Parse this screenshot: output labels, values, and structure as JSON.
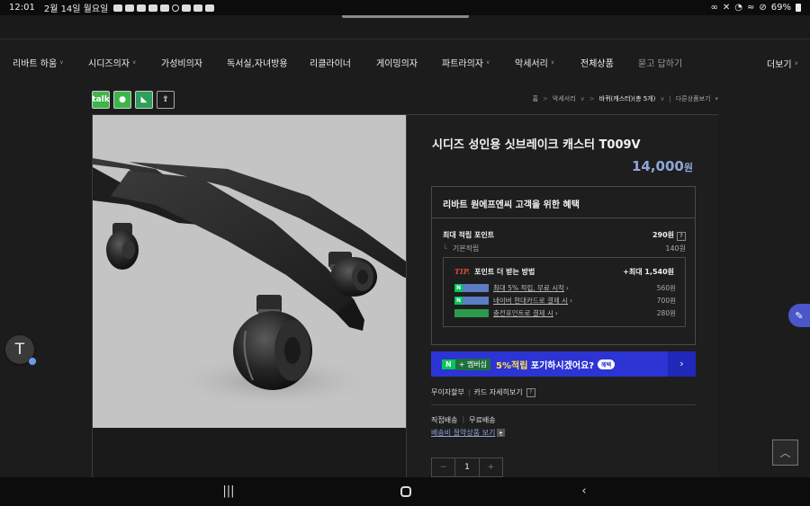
{
  "status_bar": {
    "time": "12:01",
    "date": "2월 14일 월요일",
    "battery": "69%"
  },
  "nav": {
    "items": [
      {
        "label": "리바트 하움",
        "has_dropdown": true
      },
      {
        "label": "시디즈의자",
        "has_dropdown": true
      },
      {
        "label": "가성비의자",
        "has_dropdown": false
      },
      {
        "label": "독서실,자녀방용",
        "has_dropdown": false
      },
      {
        "label": "리클라이너",
        "has_dropdown": false
      },
      {
        "label": "게이밍의자",
        "has_dropdown": false
      },
      {
        "label": "파트라의자",
        "has_dropdown": true
      },
      {
        "label": "악세서리",
        "has_dropdown": true
      },
      {
        "label": "전체상품",
        "has_dropdown": false
      },
      {
        "label": "묻고 답하기",
        "has_dropdown": false
      }
    ],
    "more": "더보기"
  },
  "breadcrumb": {
    "home": "홈",
    "category": "악세서리",
    "current": "바퀴(캐스터)(총 5개)",
    "other": "다른상품보기"
  },
  "share_icons": [
    "talk",
    "story",
    "band",
    "share"
  ],
  "product": {
    "title": "시디즈 성인용 싯브레이크 캐스터 T009V",
    "price": "14,000",
    "currency": "원"
  },
  "benefit": {
    "header": "리바트 원에프엔씨 고객을 위한 혜택",
    "max_points_label": "최대 적립 포인트",
    "max_points_value": "290원",
    "help": "?",
    "basic_label": "기본적립",
    "basic_value": "140원",
    "tip": {
      "tag": "TIP.",
      "title": "포인트 더 받는 방법",
      "max": "+최대 1,540원",
      "rows": [
        {
          "text": "최대 5% 적립, 무료 시작",
          "amount": "560원",
          "badge": "N"
        },
        {
          "text": "네이버 현대카드로 결제 시",
          "amount": "700원",
          "badge": "N"
        },
        {
          "text": "충전포인트로 결제 시",
          "amount": "280원",
          "badge": ""
        }
      ]
    }
  },
  "banner": {
    "n": "N",
    "plus": "+ 멤버십",
    "text_pre": "",
    "text_hl": "5%적립",
    "text_post": " 포기하시겠어요?",
    "pill": "혜택",
    "arrow": "›"
  },
  "installment": {
    "label": "무이자할부",
    "card": "카드 자세히보기",
    "help": "?"
  },
  "shipping": {
    "method": "직접배송",
    "fee": "무료배송",
    "link": "배송비 절약상품 보기"
  },
  "quantity": {
    "minus": "−",
    "value": "1",
    "plus": "+"
  },
  "floating": {
    "t": "T",
    "top": "︿"
  },
  "colors": {
    "price": "#8ea6d8",
    "banner": "#2c34d4",
    "naver_green": "#03c75a",
    "tip_red": "#e04a3a"
  }
}
